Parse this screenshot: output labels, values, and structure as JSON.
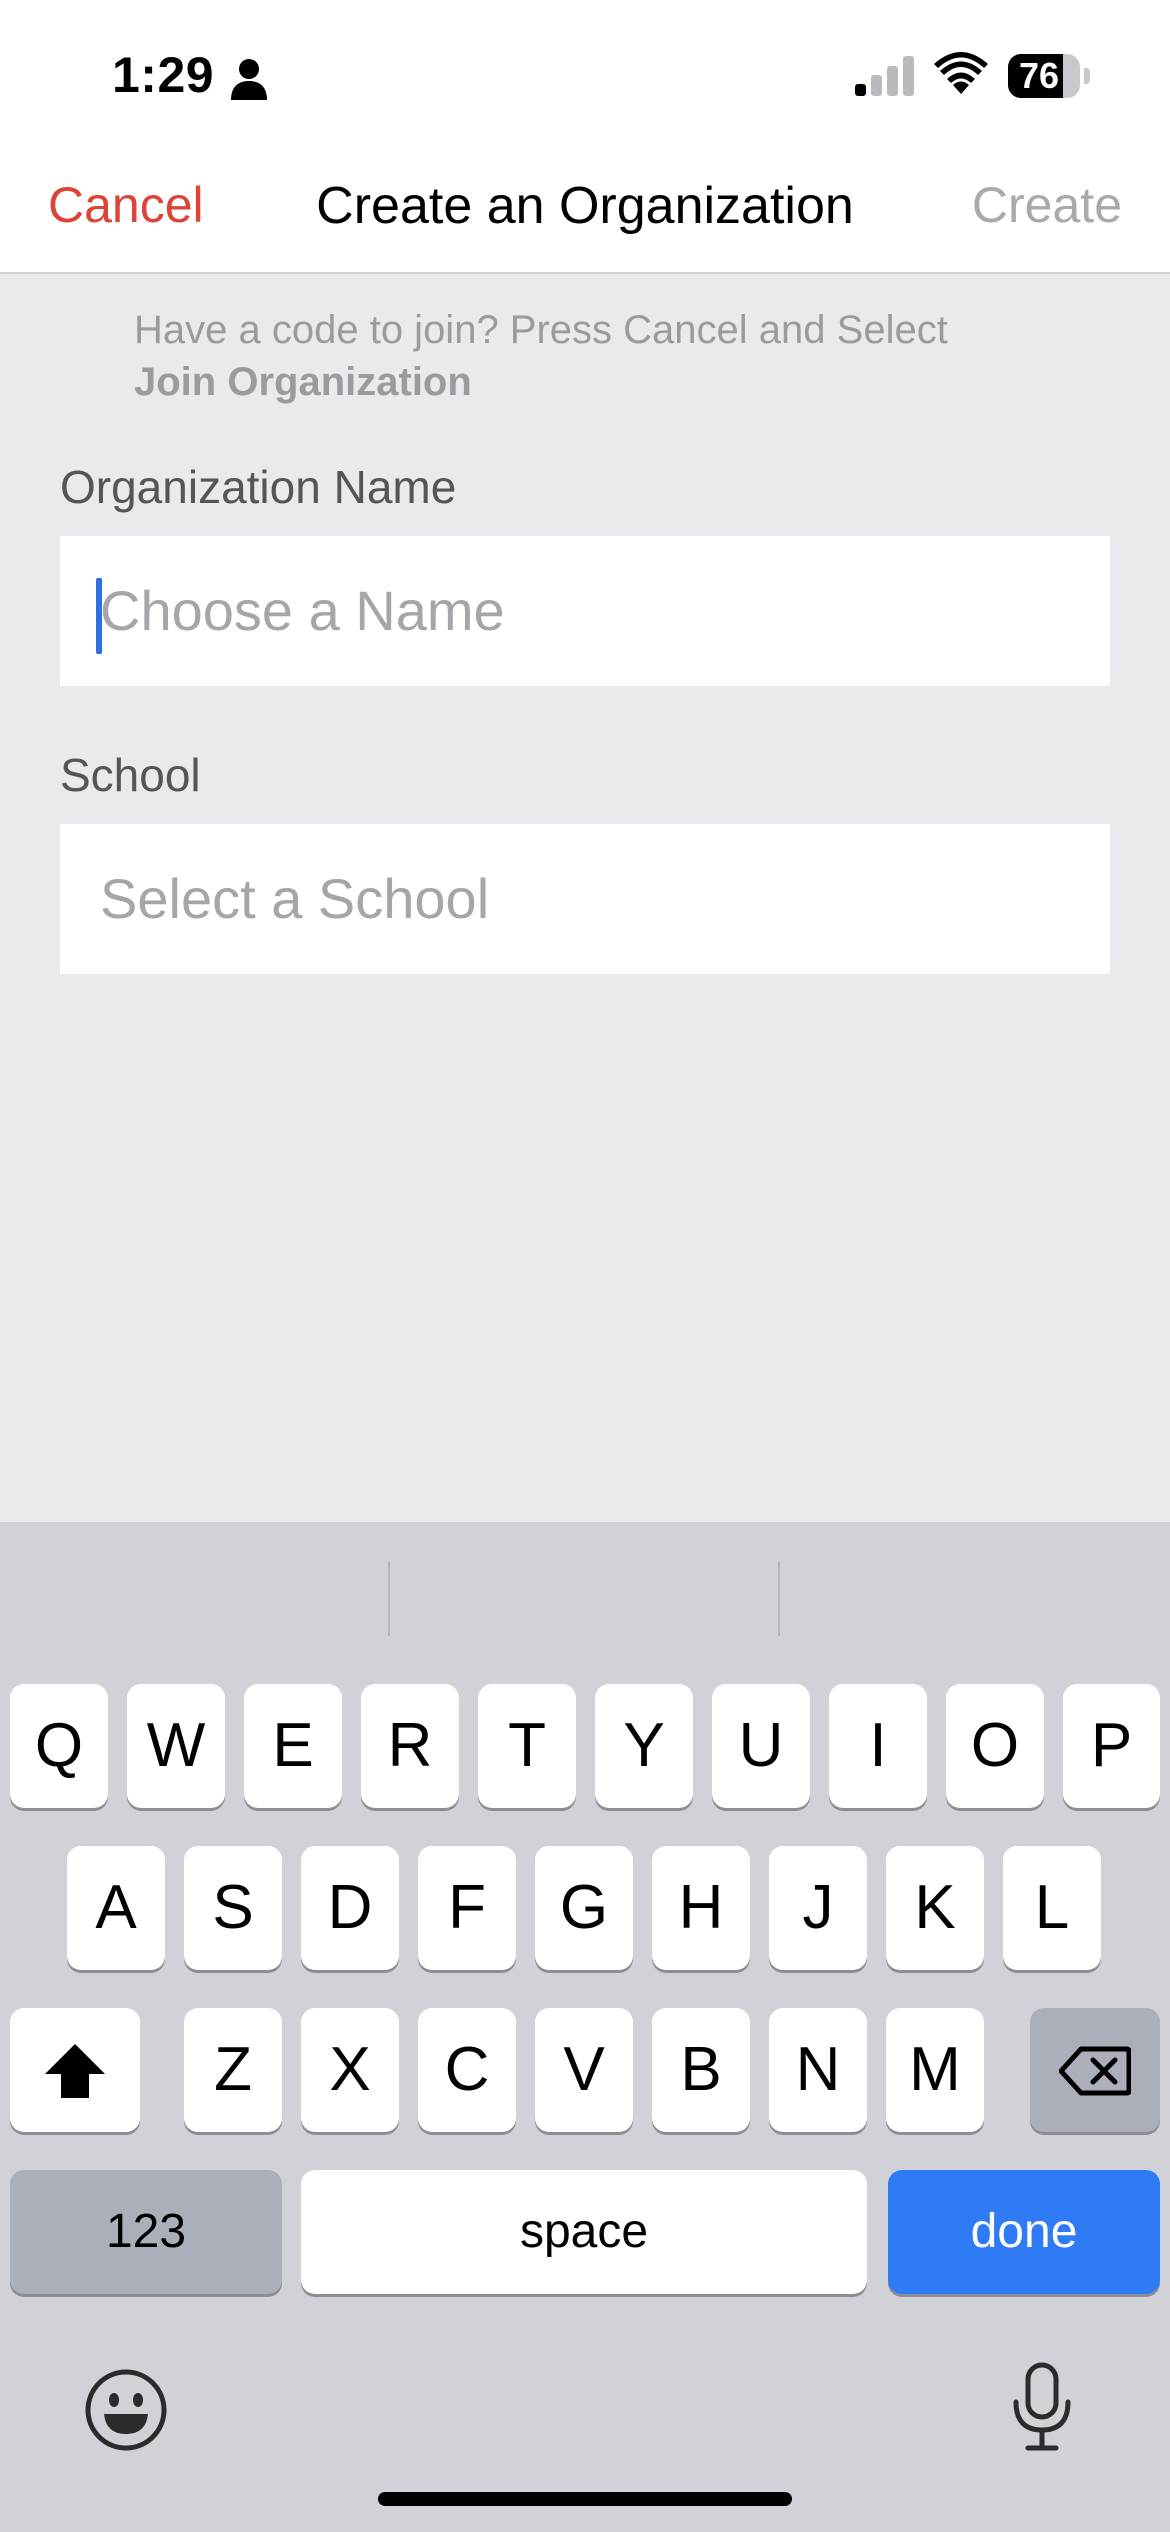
{
  "status_bar": {
    "time": "1:29",
    "battery": "76",
    "battery_level": 0.76
  },
  "nav": {
    "cancel": "Cancel",
    "title": "Create an Organization",
    "create": "Create"
  },
  "hint": {
    "line1": "Have a code to join? Press Cancel and Select",
    "line2": "Join Organization"
  },
  "org_name": {
    "label": "Organization Name",
    "placeholder": "Choose a Name"
  },
  "school": {
    "label": "School",
    "placeholder": "Select a School"
  },
  "keyboard": {
    "row1": [
      "Q",
      "W",
      "E",
      "R",
      "T",
      "Y",
      "U",
      "I",
      "O",
      "P"
    ],
    "row2": [
      "A",
      "S",
      "D",
      "F",
      "G",
      "H",
      "J",
      "K",
      "L"
    ],
    "row3": [
      "Z",
      "X",
      "C",
      "V",
      "B",
      "N",
      "M"
    ],
    "numbers": "123",
    "space": "space",
    "done": "done"
  },
  "colors": {
    "accent_red": "#dc4437",
    "accent_blue": "#2f7af5",
    "background": "#e9e9ee"
  }
}
